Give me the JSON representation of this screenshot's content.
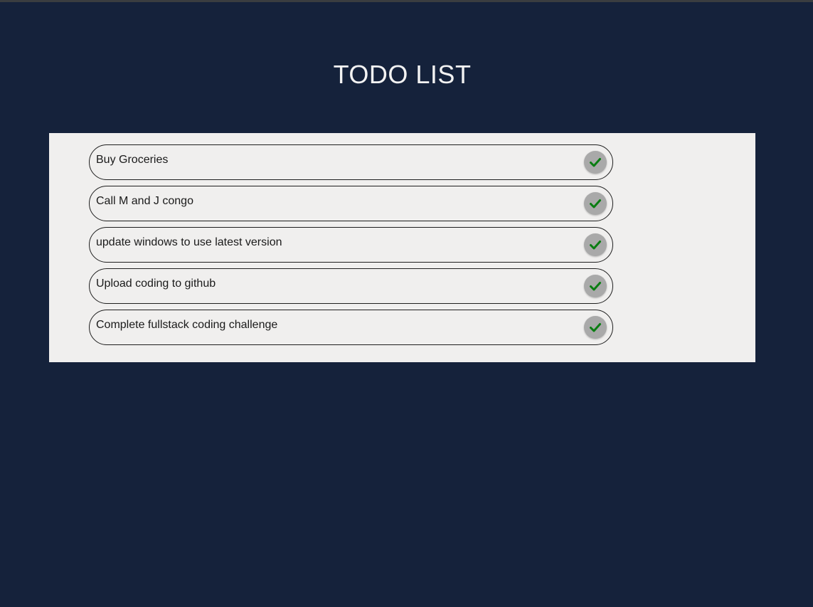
{
  "header": {
    "title": "TODO LIST"
  },
  "todos": [
    {
      "text": "Buy Groceries",
      "action_icon": "check-icon"
    },
    {
      "text": "Call M and J congo",
      "action_icon": "check-icon"
    },
    {
      "text": "update windows to use latest version",
      "action_icon": "check-icon"
    },
    {
      "text": "Upload coding to github",
      "action_icon": "check-icon"
    },
    {
      "text": "Complete fullstack coding challenge",
      "action_icon": "check-icon"
    }
  ],
  "colors": {
    "background": "#15223b",
    "panel": "#f0efee",
    "check_button": "#a9a9a9",
    "check_mark": "#0a7d12",
    "title_text": "#f2f2f2"
  }
}
